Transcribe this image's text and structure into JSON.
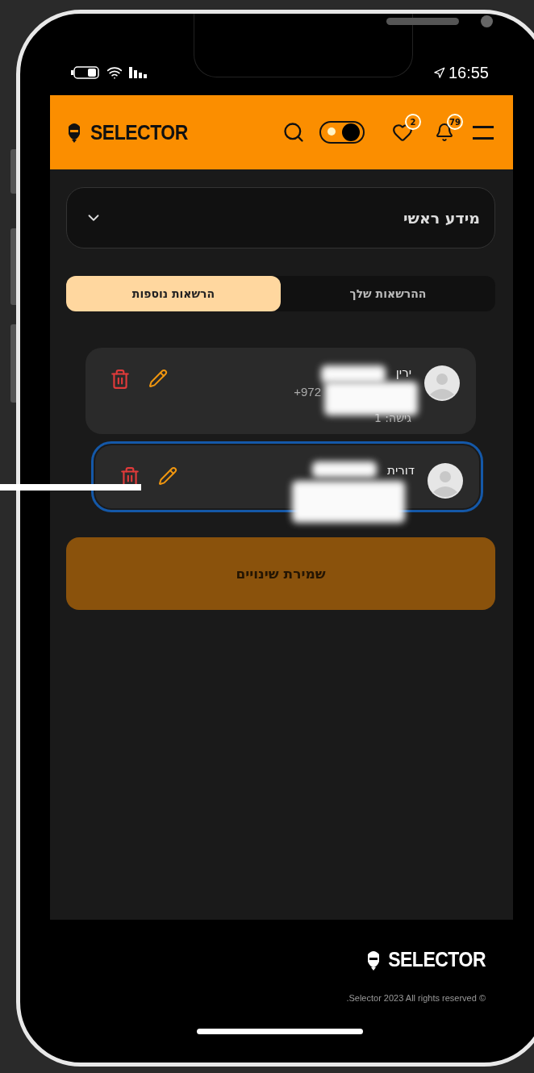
{
  "status_bar": {
    "time": "16:55"
  },
  "header": {
    "logo": "SELECTOR",
    "theme_toggle": {
      "on": true
    },
    "favorites_count": "2",
    "notifications_count": "79"
  },
  "section_select": {
    "value": "מידע ראשי"
  },
  "tabs": [
    {
      "label": "ההרשאות שלך",
      "selected": false
    },
    {
      "label": "הרשאות נוספות",
      "selected": true
    }
  ],
  "permissions": [
    {
      "name": "ירין",
      "phone": "+972",
      "access": "גישה: 1",
      "highlighted": false
    },
    {
      "name": "דורית",
      "highlighted": true
    }
  ],
  "save_button": "שמירת שינויים",
  "footer": {
    "logo": "SELECTOR",
    "copyright": ".Selector 2023 All rights reserved ©"
  }
}
